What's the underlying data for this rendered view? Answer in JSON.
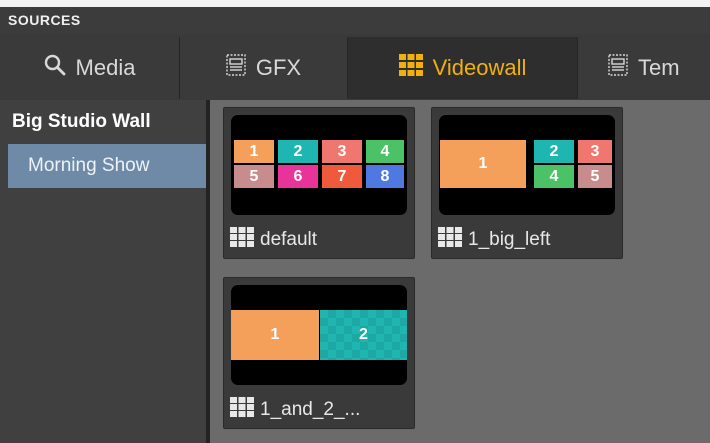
{
  "panel": {
    "title": "SOURCES"
  },
  "tabs": [
    {
      "label": "Media",
      "icon": "search-icon",
      "active": false
    },
    {
      "label": "GFX",
      "icon": "gfx-template-icon",
      "active": false
    },
    {
      "label": "Videowall",
      "icon": "videowall-grid-icon",
      "active": true
    },
    {
      "label": "Tem",
      "icon": "template-icon",
      "active": false
    }
  ],
  "colors": {
    "accent": "#f0b010",
    "selection": "#6e8aa6"
  },
  "sidebar": {
    "root_label": "Big Studio Wall",
    "selected_label": "Morning Show"
  },
  "presets": [
    {
      "name": "default",
      "icon": "videowall-grid-icon",
      "cells": [
        {
          "label": "1",
          "color": "#f5a05a"
        },
        {
          "label": "2",
          "color": "#1fb5b0"
        },
        {
          "label": "3",
          "color": "#f07670"
        },
        {
          "label": "4",
          "color": "#4cc266"
        },
        {
          "label": "5",
          "color": "#c98c8c"
        },
        {
          "label": "6",
          "color": "#e8339a"
        },
        {
          "label": "7",
          "color": "#f05a3c"
        },
        {
          "label": "8",
          "color": "#4f78e0"
        }
      ]
    },
    {
      "name": "1_big_left",
      "icon": "videowall-grid-icon",
      "cells": [
        {
          "label": "1",
          "color": "#f5a05a"
        },
        {
          "label": "2",
          "color": "#1fb5b0"
        },
        {
          "label": "3",
          "color": "#f07670"
        },
        {
          "label": "4",
          "color": "#4cc266"
        },
        {
          "label": "5",
          "color": "#c98c8c"
        }
      ]
    },
    {
      "name": "1_and_2_...",
      "icon": "videowall-grid-icon",
      "cells": [
        {
          "label": "1",
          "color": "#f5a05a"
        },
        {
          "label": "2",
          "color": "#1fb5b0"
        }
      ]
    }
  ]
}
